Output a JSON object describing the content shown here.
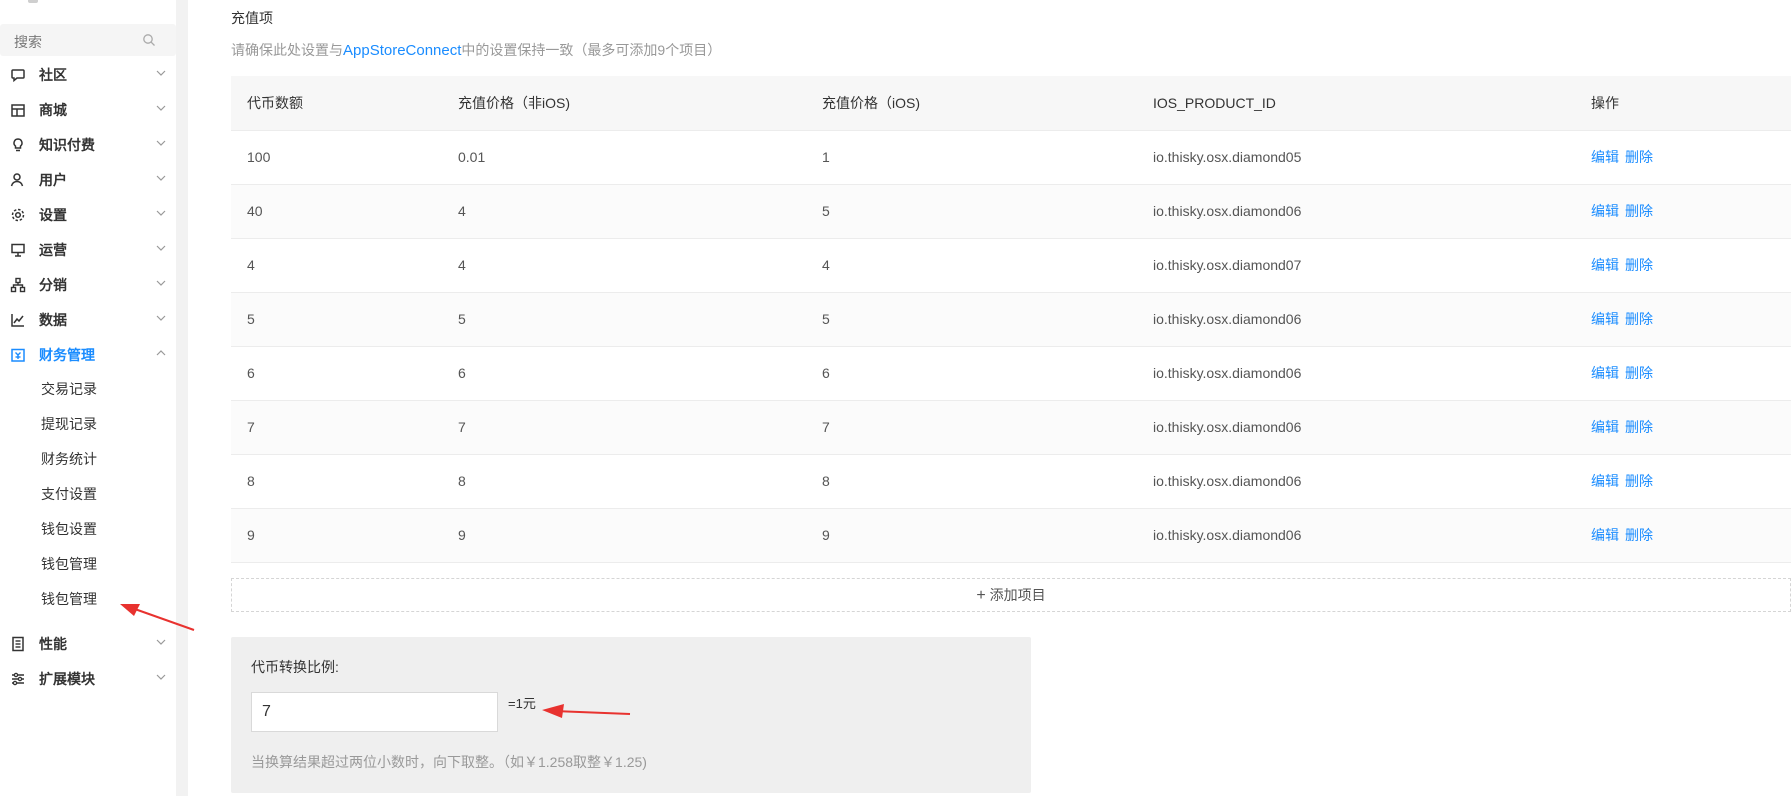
{
  "sidebar": {
    "search_placeholder": "搜索",
    "menu": [
      {
        "label": "社区",
        "icon": "chat-bubble-icon"
      },
      {
        "label": "商城",
        "icon": "shop-icon"
      },
      {
        "label": "知识付费",
        "icon": "lightbulb-icon"
      },
      {
        "label": "用户",
        "icon": "user-icon"
      },
      {
        "label": "设置",
        "icon": "gear-icon"
      },
      {
        "label": "运营",
        "icon": "presentation-icon"
      },
      {
        "label": "分销",
        "icon": "network-icon"
      },
      {
        "label": "数据",
        "icon": "line-chart-icon"
      },
      {
        "label": "财务管理",
        "icon": "finance-icon",
        "expanded": true
      },
      {
        "label": "性能",
        "icon": "performance-icon"
      },
      {
        "label": "扩展模块",
        "icon": "extension-icon"
      }
    ],
    "finance_sub": [
      {
        "label": "交易记录"
      },
      {
        "label": "提现记录"
      },
      {
        "label": "财务统计"
      },
      {
        "label": "支付设置"
      },
      {
        "label": "钱包设置"
      },
      {
        "label": "钱包管理"
      },
      {
        "label": "钱包管理"
      }
    ]
  },
  "main": {
    "section_title": "充值项",
    "hint_prefix": "请确保此处设置与",
    "hint_link": "AppStoreConnect",
    "hint_suffix": "中的设置保持一致（最多可添加9个项目）",
    "columns": [
      "代币数额",
      "充值价格（非iOS)",
      "充值价格（iOS)",
      "IOS_PRODUCT_ID",
      "操作"
    ],
    "rows": [
      {
        "amount": "100",
        "price_non_ios": "0.01",
        "price_ios": "1",
        "product_id": "io.thisky.osx.diamond05"
      },
      {
        "amount": "40",
        "price_non_ios": "4",
        "price_ios": "5",
        "product_id": "io.thisky.osx.diamond06"
      },
      {
        "amount": "4",
        "price_non_ios": "4",
        "price_ios": "4",
        "product_id": "io.thisky.osx.diamond07"
      },
      {
        "amount": "5",
        "price_non_ios": "5",
        "price_ios": "5",
        "product_id": "io.thisky.osx.diamond06"
      },
      {
        "amount": "6",
        "price_non_ios": "6",
        "price_ios": "6",
        "product_id": "io.thisky.osx.diamond06"
      },
      {
        "amount": "7",
        "price_non_ios": "7",
        "price_ios": "7",
        "product_id": "io.thisky.osx.diamond06"
      },
      {
        "amount": "8",
        "price_non_ios": "8",
        "price_ios": "8",
        "product_id": "io.thisky.osx.diamond06"
      },
      {
        "amount": "9",
        "price_non_ios": "9",
        "price_ios": "9",
        "product_id": "io.thisky.osx.diamond06"
      }
    ],
    "edit_label": "编辑",
    "delete_label": "删除",
    "add_label": "添加项目",
    "ratio": {
      "label": "代币转换比例:",
      "value": "7",
      "unit": "=1元",
      "note": "当换算结果超过两位小数时，向下取整。（如￥1.258取整￥1.25)"
    }
  },
  "colors": {
    "accent": "#1a8cff",
    "annotation_arrow": "#e8322f"
  }
}
